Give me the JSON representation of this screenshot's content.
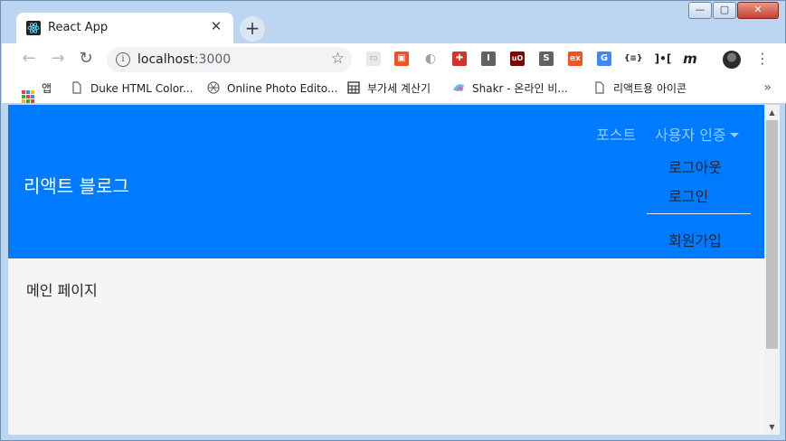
{
  "tab": {
    "title": "React App",
    "close": "✕"
  },
  "new_tab": "+",
  "window_controls": {
    "minimize": "—",
    "maximize": "▢",
    "close": "✕"
  },
  "toolbar": {
    "back": "←",
    "forward": "→",
    "reload": "↻",
    "url_host": "localhost",
    "url_port": ":3000",
    "star": "☆",
    "menu": "⋮"
  },
  "extensions": [
    {
      "name": "ext-1",
      "glyph": "▭",
      "color": "#b0b0b0"
    },
    {
      "name": "ext-2",
      "glyph": "▣",
      "color": "#f25022"
    },
    {
      "name": "ext-3",
      "glyph": "◐",
      "color": "#9aa0a6"
    },
    {
      "name": "ext-4",
      "glyph": "✚",
      "color": "#d93025"
    },
    {
      "name": "ext-5",
      "glyph": "I",
      "color": "#5f6368"
    },
    {
      "name": "ext-6",
      "glyph": "uO",
      "color": "#800000"
    },
    {
      "name": "ext-7",
      "glyph": "S",
      "color": "#5f6368"
    },
    {
      "name": "ext-8",
      "glyph": "ex",
      "color": "#f4511e"
    },
    {
      "name": "ext-9",
      "glyph": "G",
      "color": "#4285f4"
    },
    {
      "name": "ext-10",
      "glyph": "{≡}",
      "color": "#ffffff"
    },
    {
      "name": "ext-11",
      "glyph": "]•[",
      "color": "#ffffff"
    },
    {
      "name": "ext-12",
      "glyph": "m",
      "color": "#ffffff"
    }
  ],
  "bookmarks": {
    "items": [
      {
        "label": "앱"
      },
      {
        "label": "Duke HTML Color..."
      },
      {
        "label": "Online Photo Edito..."
      },
      {
        "label": "부가세 계산기"
      },
      {
        "label": "Shakr - 온라인 비..."
      },
      {
        "label": "리액트용 아이콘"
      }
    ],
    "more": "»"
  },
  "page": {
    "brand": "리액트 블로그",
    "nav_post": "포스트",
    "nav_auth": "사용자 인증",
    "dropdown": {
      "logout": "로그아웃",
      "login": "로그인",
      "signup": "회원가입"
    },
    "main_text": "메인 페이지"
  },
  "scrollbar": {
    "up": "▲",
    "down": "▼"
  }
}
